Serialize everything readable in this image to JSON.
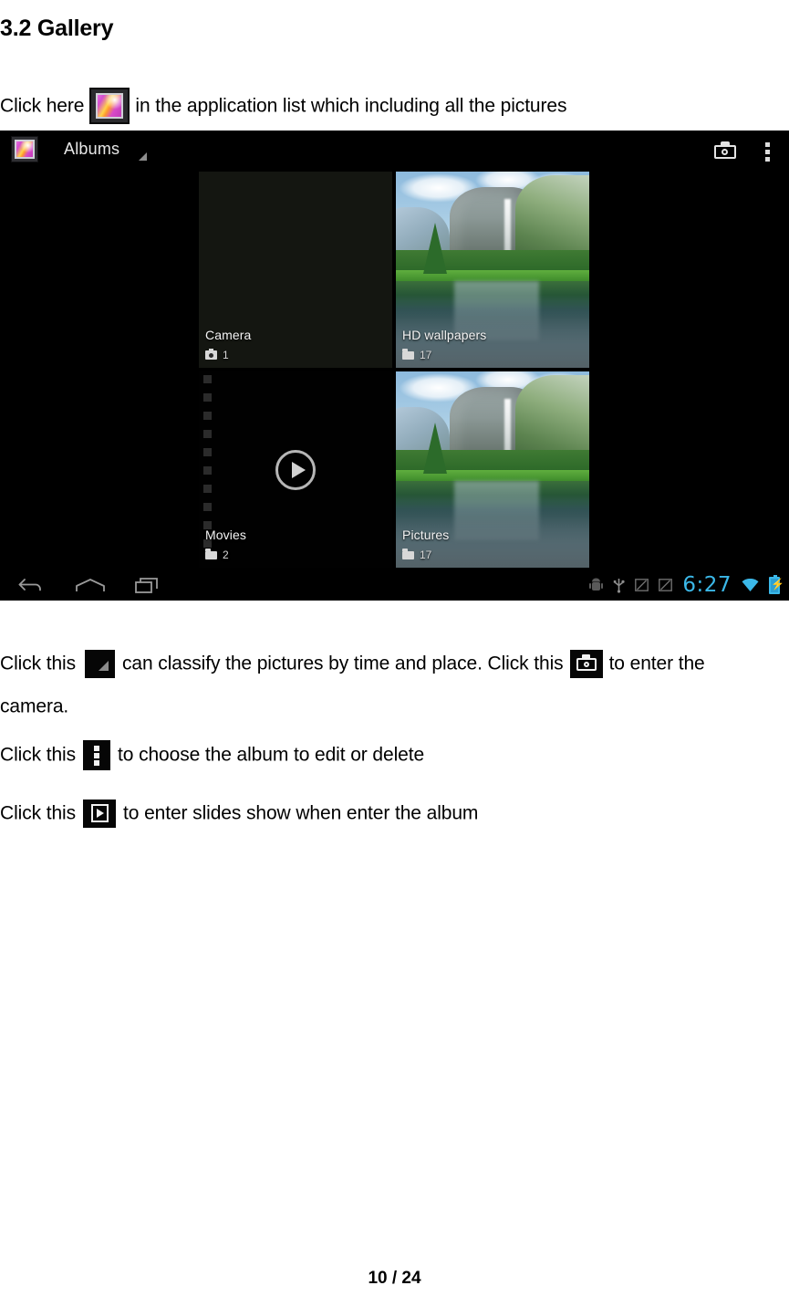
{
  "document": {
    "heading": "3.2 Gallery",
    "page_footer": "10 / 24",
    "lines": {
      "click_here_prefix": "Click here",
      "click_here_suffix": "in the application list which including all the pictures",
      "classify_prefix": "Click this",
      "classify_middle": "can classify the pictures by time and place. Click this",
      "classify_suffix": "to enter the",
      "camera_word": "camera.",
      "choose_prefix": "Click this",
      "choose_suffix": "to choose the album to edit or delete",
      "slides_prefix": "Click this",
      "slides_suffix": "to enter slides show when enter the album"
    },
    "inline_icons": {
      "gallery": "gallery-app-icon",
      "triangle": "sort-triangle-icon",
      "camera": "camera-icon",
      "overflow": "overflow-menu-icon",
      "slideshow": "slideshow-icon"
    }
  },
  "screenshot": {
    "action_bar": {
      "app_icon": "gallery-app-icon",
      "title": "Albums",
      "dropdown_caret": "caret-icon",
      "camera_button": "camera-icon",
      "overflow_button": "overflow-menu-icon"
    },
    "albums": [
      {
        "name": "Camera",
        "count": "1",
        "meta_icon": "camera-icon",
        "thumb": "dark"
      },
      {
        "name": "HD wallpapers",
        "count": "17",
        "meta_icon": "folder-icon",
        "thumb": "photo"
      },
      {
        "name": "Movies",
        "count": "2",
        "meta_icon": "folder-icon",
        "thumb": "film"
      },
      {
        "name": "Pictures",
        "count": "17",
        "meta_icon": "folder-icon",
        "thumb": "photo"
      }
    ],
    "nav_bar": {
      "back": "back-icon",
      "home": "home-icon",
      "recents": "recent-apps-icon"
    },
    "status_bar": {
      "debug_icon": "android-debug-icon",
      "usb_icon": "usb-icon",
      "screenshot_icon_1": "screenshot-icon",
      "screenshot_icon_2": "screenshot-icon",
      "time": "6:27",
      "wifi_icon": "wifi-icon",
      "battery_icon": "battery-charging-icon",
      "accent_color": "#33b5e5"
    }
  }
}
